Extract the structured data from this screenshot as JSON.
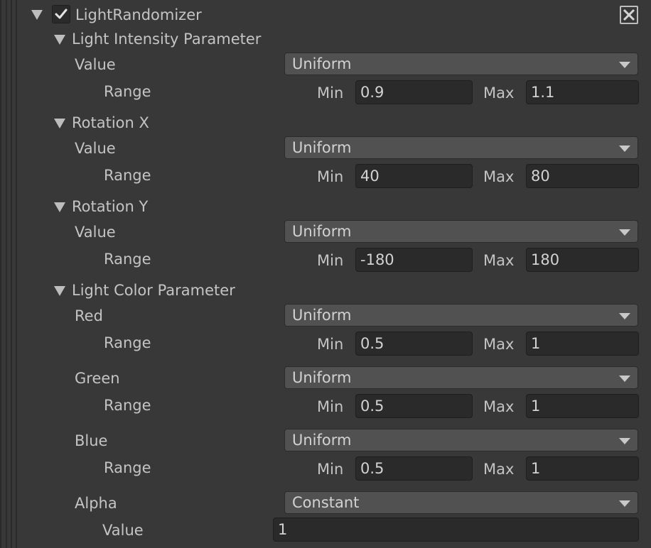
{
  "component": {
    "title": "LightRandomizer",
    "enabled": true
  },
  "sections": [
    {
      "name": "Light Intensity Parameter",
      "rows": [
        {
          "label": "Value",
          "mode": "Uniform",
          "range_label": "Range",
          "min_label": "Min",
          "min": "0.9",
          "max_label": "Max",
          "max": "1.1"
        }
      ]
    },
    {
      "name": "Rotation X",
      "rows": [
        {
          "label": "Value",
          "mode": "Uniform",
          "range_label": "Range",
          "min_label": "Min",
          "min": "40",
          "max_label": "Max",
          "max": "80"
        }
      ]
    },
    {
      "name": "Rotation Y",
      "rows": [
        {
          "label": "Value",
          "mode": "Uniform",
          "range_label": "Range",
          "min_label": "Min",
          "min": "-180",
          "max_label": "Max",
          "max": "180"
        }
      ]
    },
    {
      "name": "Light Color Parameter",
      "rows": [
        {
          "label": "Red",
          "mode": "Uniform",
          "range_label": "Range",
          "min_label": "Min",
          "min": "0.5",
          "max_label": "Max",
          "max": "1"
        },
        {
          "label": "Green",
          "mode": "Uniform",
          "range_label": "Range",
          "min_label": "Min",
          "min": "0.5",
          "max_label": "Max",
          "max": "1"
        },
        {
          "label": "Blue",
          "mode": "Uniform",
          "range_label": "Range",
          "min_label": "Min",
          "min": "0.5",
          "max_label": "Max",
          "max": "1"
        }
      ],
      "alpha": {
        "label": "Alpha",
        "mode": "Constant",
        "value_label": "Value",
        "value": "1"
      }
    }
  ],
  "icons": {
    "foldout": "triangle-down-icon",
    "check": "checkmark-icon",
    "close": "close-x-icon"
  }
}
